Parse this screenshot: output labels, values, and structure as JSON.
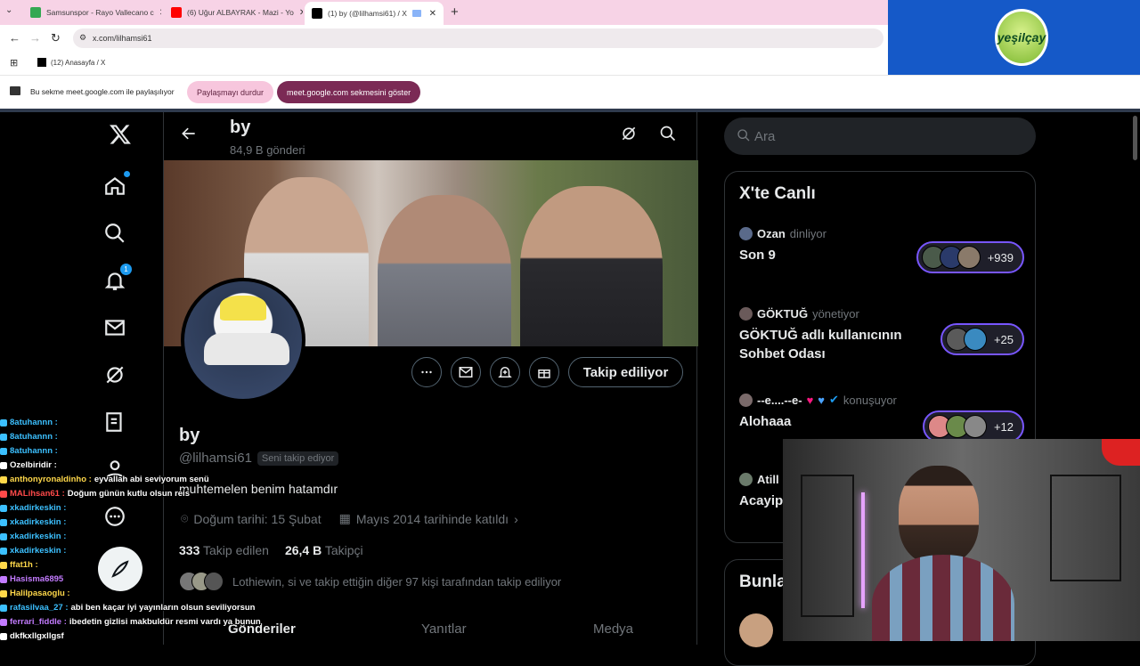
{
  "browser": {
    "tabs": [
      {
        "title": "Samsunspor - Rayo Vallecano c",
        "color": "#34a853"
      },
      {
        "title": "(6) Uğur ALBAYRAK - Mazi - Yo",
        "color": "#ff0000"
      },
      {
        "title": "(1) by (@lilhamsi61) / X",
        "color": "#000000"
      }
    ],
    "url": "x.com/lilhamsi61",
    "bookmark": "(12) Anasayfa / X"
  },
  "share_bar": {
    "message": "Bu sekme meet.google.com ile paylaşılıyor",
    "stop_label": "Paylaşmayı durdur",
    "show_label": "meet.google.com sekmesini göster"
  },
  "logo_text": "yeşilçay",
  "nav": {
    "notification_count": "1"
  },
  "profile_header": {
    "name": "by",
    "post_count": "84,9 B gönderi"
  },
  "profile": {
    "name": "by",
    "handle": "@lilhamsi61",
    "follows_you": "Seni takip ediyor",
    "bio": "muhtemelen benim hatamdır",
    "birthday": "Doğum tarihi: 15 Şubat",
    "joined": "Mayıs 2014 tarihinde katıldı",
    "following_count": "333",
    "following_label": "Takip edilen",
    "followers_count": "26,4 B",
    "followers_label": "Takipçi",
    "followed_by": "Lothiewin, si ve takip ettiğin diğer 97 kişi tarafından takip ediliyor",
    "follow_button": "Takip ediliyor"
  },
  "profile_tabs": [
    "Gönderiler",
    "Yanıtlar",
    "Medya"
  ],
  "search": {
    "placeholder": "Ara"
  },
  "live": {
    "title": "X'te Canlı",
    "items": [
      {
        "host": "Ozan",
        "verb": "dinliyor",
        "title": "Son 9",
        "count": "+939"
      },
      {
        "host": "GÖKTUĞ",
        "verb": "yönetiyor",
        "title": "GÖKTUĞ adlı kullanıcının Sohbet Odası",
        "count": "+25"
      },
      {
        "host": "--e....--e-",
        "verb": "konuşuyor",
        "title": "Alohaaa",
        "count": "+12"
      },
      {
        "host": "Atill",
        "verb": "",
        "title": "Acayip",
        "count": ""
      }
    ]
  },
  "right_section_title": "Bunla",
  "chat": [
    {
      "user": "8atuhannn :",
      "msg": "",
      "color": "#3cc0ff"
    },
    {
      "user": "8atuhannn :",
      "msg": "",
      "color": "#3cc0ff"
    },
    {
      "user": "8atuhannn :",
      "msg": "",
      "color": "#3cc0ff"
    },
    {
      "user": "Ozelbiridir :",
      "msg": "",
      "color": "#ffffff"
    },
    {
      "user": "anthonyronaldinho :",
      "msg": "eyvallah abi seviyorum senü",
      "color": "#ffd84a"
    },
    {
      "user": "MALihsan61 :",
      "msg": "Doğum günün kutlu olsun reis",
      "color": "#ff4a4a"
    },
    {
      "user": "xkadirkeskin :",
      "msg": "",
      "color": "#3cc0ff"
    },
    {
      "user": "xkadirkeskin :",
      "msg": "",
      "color": "#3cc0ff"
    },
    {
      "user": "xkadirkeskin :",
      "msg": "",
      "color": "#3cc0ff"
    },
    {
      "user": "xkadirkeskin :",
      "msg": "",
      "color": "#3cc0ff"
    },
    {
      "user": "ffat1h :",
      "msg": "",
      "color": "#ffd84a"
    },
    {
      "user": "Hasisma6895",
      "msg": "",
      "color": "#c37bff"
    },
    {
      "user": "Halilpasaoglu :",
      "msg": "",
      "color": "#ffd84a"
    },
    {
      "user": "rafasilvaa_27 :",
      "msg": "abi ben kaçar iyi yayınların olsun seviliyorsun",
      "color": "#3cc0ff"
    },
    {
      "user": "ferrari_fiddle :",
      "msg": "ibedetin gizlisi makbuldür resmi vardı ya bunun",
      "color": "#c37bff"
    },
    {
      "user": "dkfkxllgxllgsf",
      "msg": "",
      "color": "#ffffff"
    }
  ]
}
